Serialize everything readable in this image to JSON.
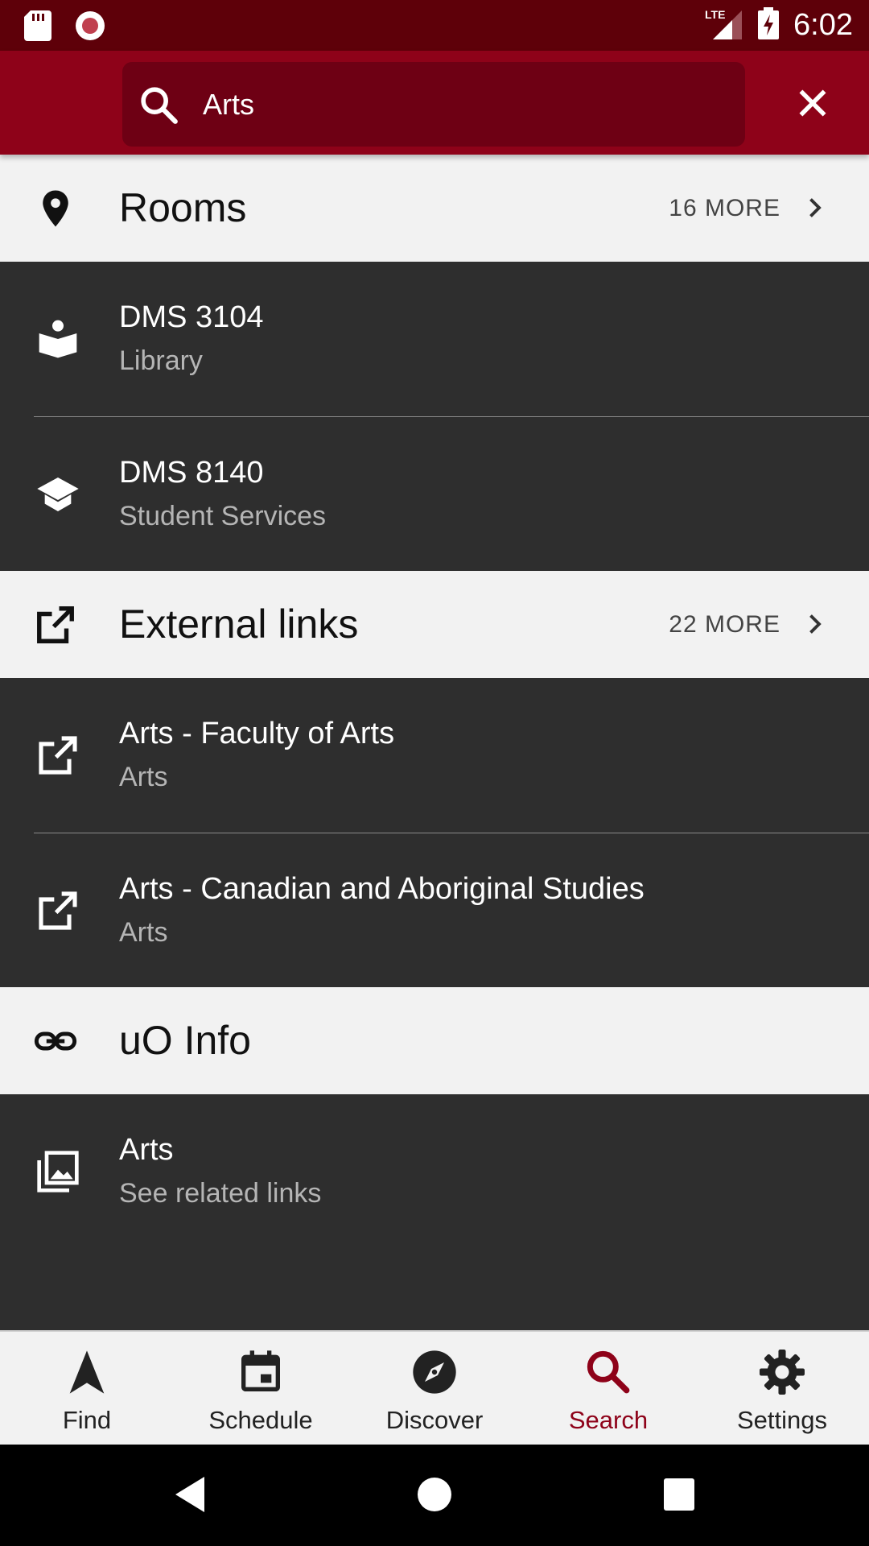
{
  "status_bar": {
    "time": "6:02",
    "network": "LTE",
    "icons": [
      "sd-card-icon",
      "record-icon",
      "signal-icon",
      "battery-charging-icon"
    ]
  },
  "search": {
    "query": "Arts",
    "icon": "search-icon",
    "clear_icon": "close-icon"
  },
  "sections": {
    "rooms": {
      "title": "Rooms",
      "more": "16 MORE",
      "icon": "location-pin-icon",
      "items": [
        {
          "title": "DMS 3104",
          "subtitle": "Library",
          "icon": "book-reader-icon"
        },
        {
          "title": "DMS 8140",
          "subtitle": "Student Services",
          "icon": "graduation-cap-icon"
        }
      ]
    },
    "external_links": {
      "title": "External links",
      "more": "22 MORE",
      "icon": "open-external-icon",
      "items": [
        {
          "title": "Arts - Faculty of Arts",
          "subtitle": "Arts",
          "icon": "open-external-icon"
        },
        {
          "title": "Arts - Canadian and Aboriginal Studies",
          "subtitle": "Arts",
          "icon": "open-external-icon"
        }
      ]
    },
    "uo_info": {
      "title": "uO Info",
      "icon": "link-icon",
      "items": [
        {
          "title": "Arts",
          "subtitle": "See related links",
          "icon": "image-collection-icon"
        }
      ]
    }
  },
  "bottom_nav": {
    "active": "Search",
    "accent_color": "#8e0219",
    "items": [
      {
        "label": "Find",
        "icon": "navigation-arrow-icon"
      },
      {
        "label": "Schedule",
        "icon": "calendar-icon"
      },
      {
        "label": "Discover",
        "icon": "compass-icon"
      },
      {
        "label": "Search",
        "icon": "search-icon"
      },
      {
        "label": "Settings",
        "icon": "gear-icon"
      }
    ]
  },
  "colors": {
    "status_bar": "#5e0009",
    "app_bar": "#8e0219",
    "search_field": "#6e0014",
    "list_background": "#2e2e2e",
    "section_header_background": "#f2f2f2"
  }
}
